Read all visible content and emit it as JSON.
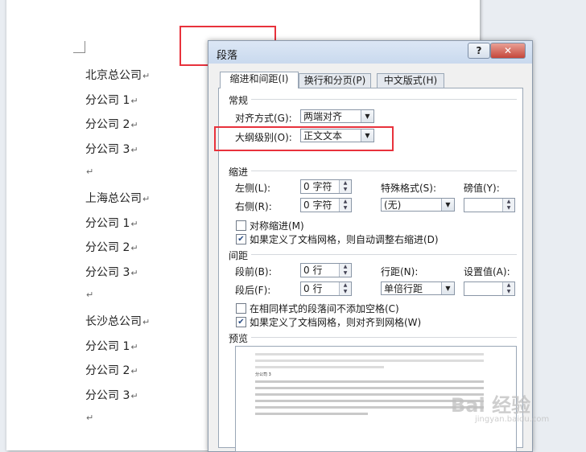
{
  "document": {
    "lines": [
      "北京总公司",
      "分公司 1",
      "分公司 2",
      "分公司 3",
      "",
      "上海总公司",
      "分公司 1",
      "分公司 2",
      "分公司 3",
      "",
      "长沙总公司",
      "分公司 1",
      "分公司 2",
      "分公司 3",
      ""
    ],
    "paragraph_mark": "↵"
  },
  "dialog": {
    "title": "段落",
    "help_label": "?",
    "close_label": "✕",
    "tabs": [
      {
        "label": "缩进和间距(I)",
        "active": true
      },
      {
        "label": "换行和分页(P)",
        "active": false
      },
      {
        "label": "中文版式(H)",
        "active": false
      }
    ],
    "general": {
      "title": "常规",
      "alignment_label": "对齐方式(G):",
      "alignment_value": "两端对齐",
      "outline_label": "大纲级别(O):",
      "outline_value": "正文文本"
    },
    "indent": {
      "title": "缩进",
      "left_label": "左侧(L):",
      "left_value": "0 字符",
      "right_label": "右侧(R):",
      "right_value": "0 字符",
      "special_label": "特殊格式(S):",
      "special_value": "(无)",
      "by_label": "磅值(Y):",
      "by_value": "",
      "mirror_label": "对称缩进(M)",
      "mirror_checked": false,
      "auto_adjust_label": "如果定义了文档网格，则自动调整右缩进(D)",
      "auto_adjust_checked": true
    },
    "spacing": {
      "title": "间距",
      "before_label": "段前(B):",
      "before_value": "0 行",
      "after_label": "段后(F):",
      "after_value": "0 行",
      "line_label": "行距(N):",
      "line_value": "单倍行距",
      "at_label": "设置值(A):",
      "at_value": "",
      "no_space_label": "在相同样式的段落间不添加空格(C)",
      "no_space_checked": false,
      "snap_grid_label": "如果定义了文档网格，则对齐到网格(W)",
      "snap_grid_checked": true
    },
    "preview": {
      "title": "预览",
      "sample_text": "分公司 3"
    }
  },
  "watermark": {
    "brand": "Bai 经验",
    "url": "jingyan.baidu.com"
  },
  "colors": {
    "annotation": "#e8323c",
    "title_bar": "#d3e1f2",
    "check": "#2a4d85"
  }
}
